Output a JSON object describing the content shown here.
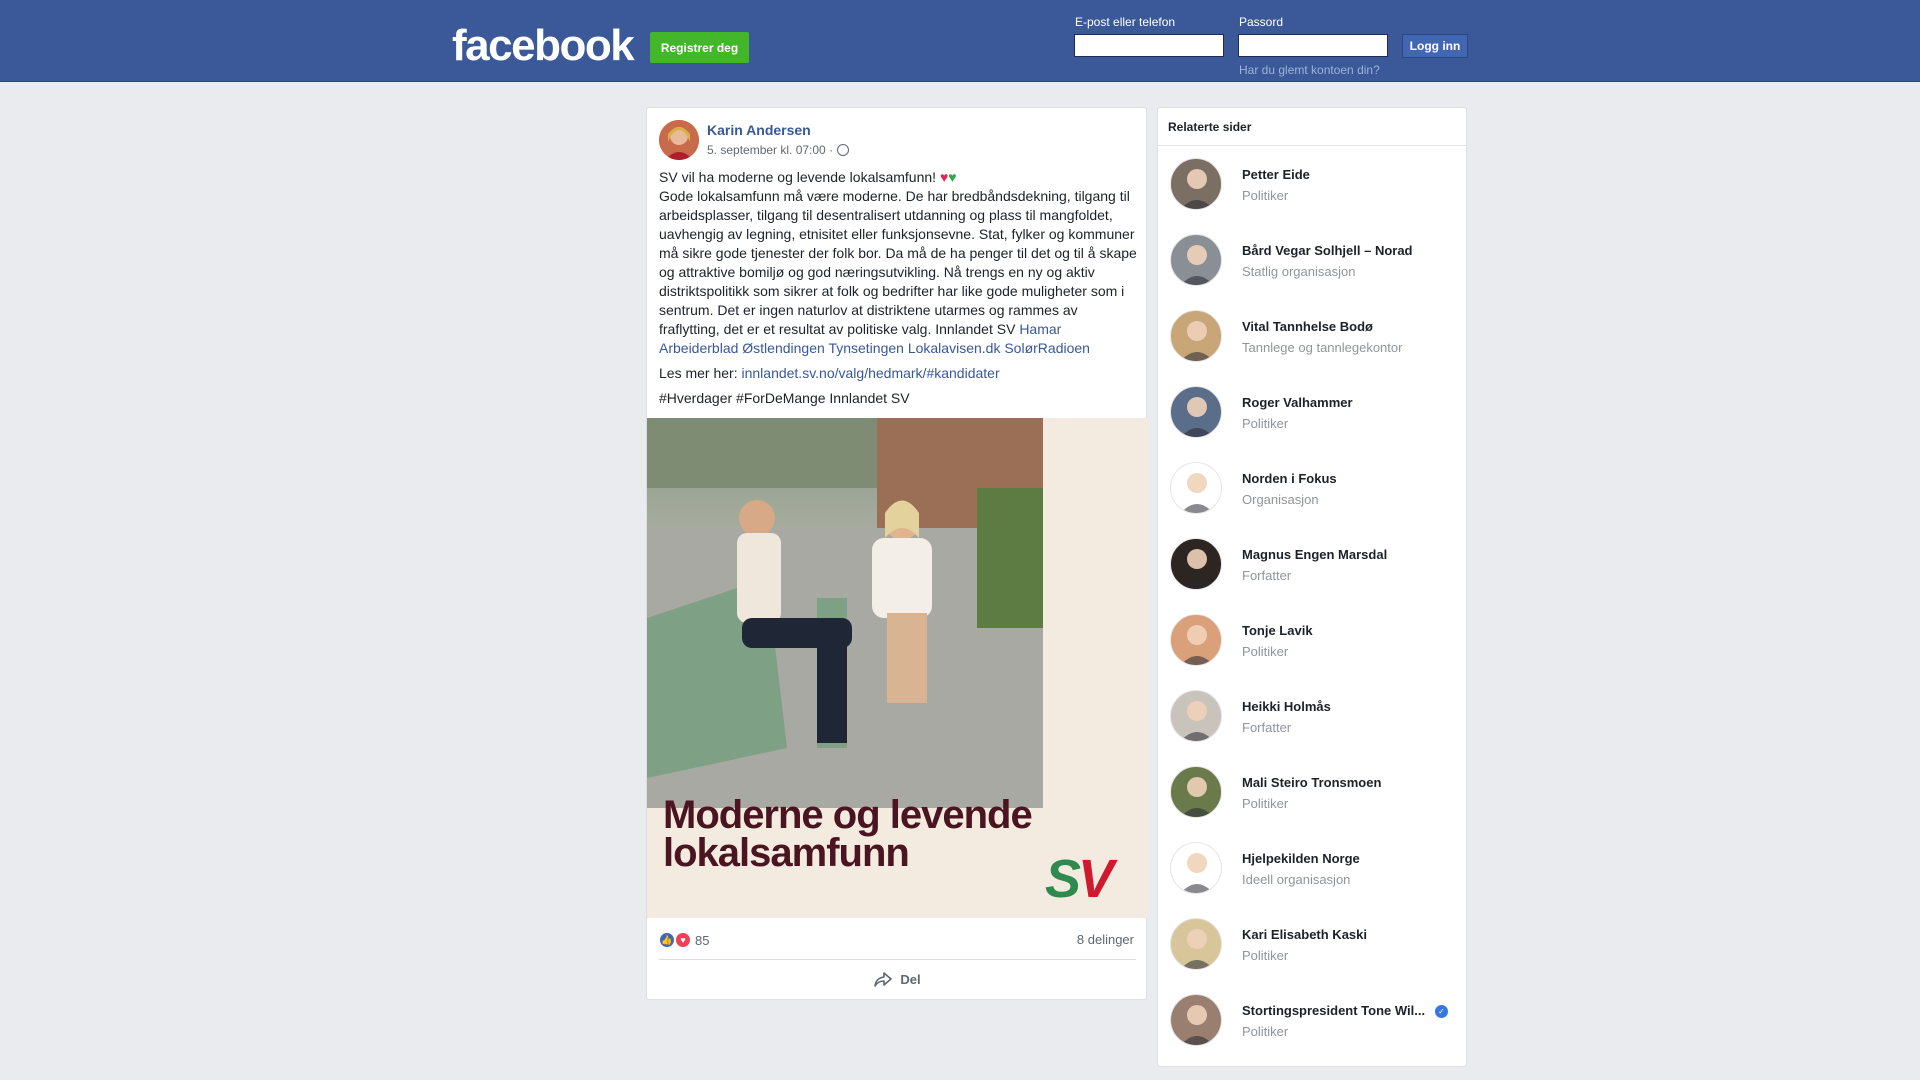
{
  "header": {
    "logo": "facebook",
    "register_label": "Registrer deg",
    "email_label": "E-post eller telefon",
    "password_label": "Passord",
    "login_label": "Logg inn",
    "forgot_label": "Har du glemt kontoen din?"
  },
  "post": {
    "author": "Karin Andersen",
    "date": "5. september kl. 07:00 ·",
    "headline": "SV vil ha moderne og levende lokalsamfunn!",
    "body": "Gode lokalsamfunn må være moderne. De har bredbåndsdekning, tilgang til arbeidsplasser, tilgang til desentralisert utdanning og plass til mangfoldet, uavhengig av legning, etnisitet eller funksjonsevne. Stat, fylker og kommuner må sikre gode tjenester der folk bor. Da må de ha penger til det og til å skape og attraktive bomiljø og god næringsutvikling. Nå trengs en ny og aktiv distriktspolitikk som sikrer at folk og bedrifter har like gode muligheter som i sentrum. Det er ingen naturlov at distriktene utarmes og rammes av fraflytting, det er et resultat av politiske valg. Innlandet SV",
    "tags": [
      {
        "label": "Hamar Arbeiderblad"
      },
      {
        "label": "Østlendingen"
      },
      {
        "label": "Tynsetingen"
      },
      {
        "label": "Lokalavisen.dk"
      },
      {
        "label": "SolørRadioen"
      }
    ],
    "read_more_label": "Les mer her:",
    "read_more_link": "innlandet.sv.no/valg/hedmark/#kandidater",
    "hashtags": "#Hverdager #ForDeMange Innlandet SV",
    "image_headline_line1": "Moderne og levende",
    "image_headline_line2": "lokalsamfunn",
    "image_logo": "SV",
    "reactions_count": "85",
    "shares": "8 delinger",
    "share_action": "Del"
  },
  "related": {
    "title": "Relaterte sider",
    "items": [
      {
        "name": "Petter Eide",
        "category": "Politiker",
        "color": "#7b6e63"
      },
      {
        "name": "Bård Vegar Solhjell – Norad",
        "category": "Statlig organisasjon",
        "color": "#8a8f96"
      },
      {
        "name": "Vital Tannhelse Bodø",
        "category": "Tannlege og tannlegekontor",
        "color": "#c9a678"
      },
      {
        "name": "Roger Valhammer",
        "category": "Politiker",
        "color": "#5a6e8a"
      },
      {
        "name": "Norden i Fokus",
        "category": "Organisasjon",
        "color": "#ffffff"
      },
      {
        "name": "Magnus Engen Marsdal",
        "category": "Forfatter",
        "color": "#2c2522"
      },
      {
        "name": "Tonje Lavik",
        "category": "Politiker",
        "color": "#d9a07a"
      },
      {
        "name": "Heikki Holmås",
        "category": "Forfatter",
        "color": "#c8c4bc"
      },
      {
        "name": "Mali Steiro Tronsmoen",
        "category": "Politiker",
        "color": "#6b7a4a"
      },
      {
        "name": "Hjelpekilden Norge",
        "category": "Ideell organisasjon",
        "color": "#ffffff"
      },
      {
        "name": "Kari Elisabeth Kaski",
        "category": "Politiker",
        "color": "#d8c69a"
      },
      {
        "name": "Stortingspresident Tone Wil...",
        "category": "Politiker",
        "color": "#9a7f70",
        "verified": true
      }
    ]
  }
}
